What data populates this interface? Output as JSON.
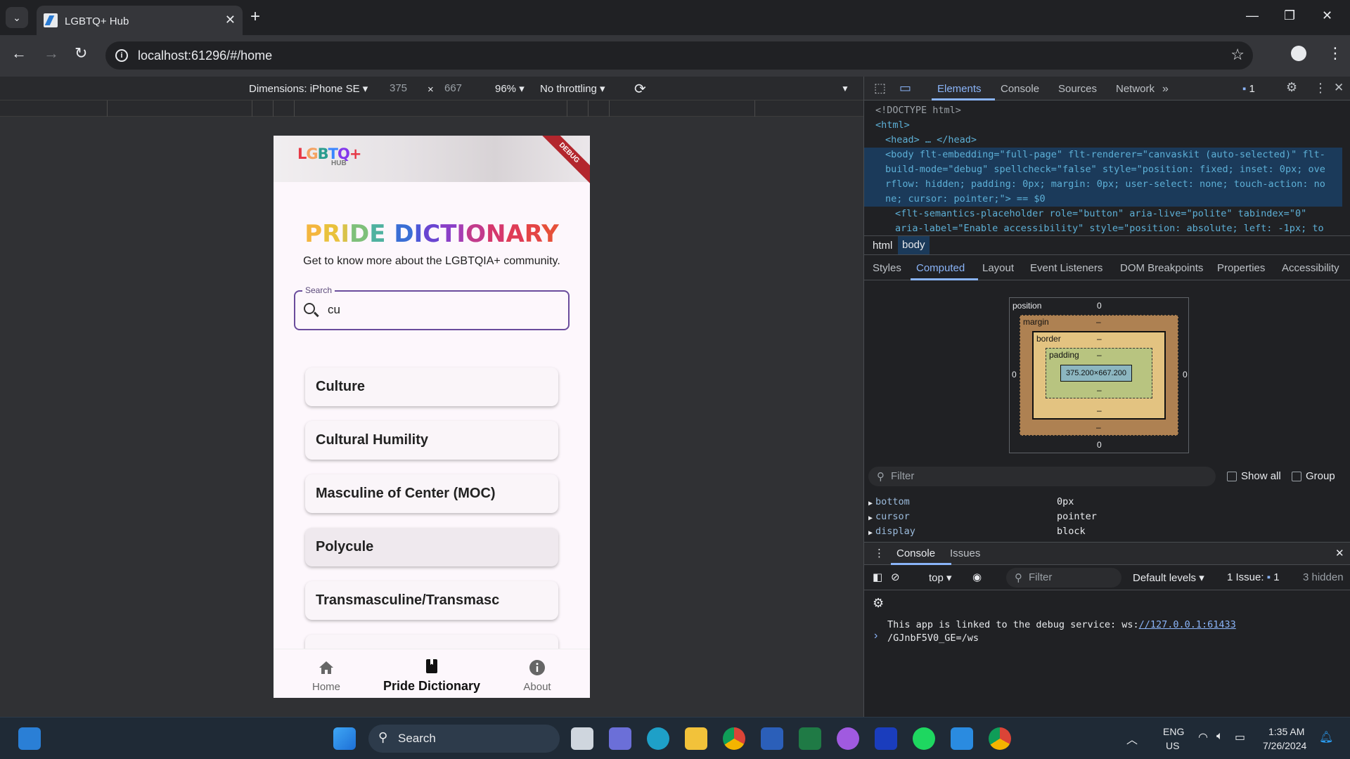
{
  "browser": {
    "tab_title": "LGBTQ+ Hub",
    "url": "localhost:61296/#/home"
  },
  "device_toolbar": {
    "dimensions": "Dimensions: iPhone SE",
    "width": "375",
    "height": "667",
    "zoom": "96%",
    "throttling": "No throttling"
  },
  "app": {
    "logo": "LGBTQ+",
    "logo_sub": "HUB",
    "debug_banner": "DEBUG",
    "title_parts": [
      {
        "text": "P",
        "color": "#f4b63f"
      },
      {
        "text": "R",
        "color": "#e9c13c"
      },
      {
        "text": "I",
        "color": "#d9c24a"
      },
      {
        "text": "D",
        "color": "#7fc07a"
      },
      {
        "text": "E",
        "color": "#4fb2a0"
      },
      {
        "text": " ",
        "color": "#000000"
      },
      {
        "text": "D",
        "color": "#3a6ed5"
      },
      {
        "text": "I",
        "color": "#4d58d8"
      },
      {
        "text": "C",
        "color": "#6a45d1"
      },
      {
        "text": "T",
        "color": "#8a3fc7"
      },
      {
        "text": "I",
        "color": "#a63eb3"
      },
      {
        "text": "O",
        "color": "#c23b8c"
      },
      {
        "text": "N",
        "color": "#d5386d"
      },
      {
        "text": "A",
        "color": "#df3c56"
      },
      {
        "text": "R",
        "color": "#e44545"
      },
      {
        "text": "Y",
        "color": "#e6503a"
      }
    ],
    "subtitle": "Get to know more about the LGBTQIA+ community.",
    "search": {
      "label": "Search",
      "value": "cu"
    },
    "results": [
      "Culture",
      "Cultural Humility",
      "Masculine of Center (MOC)",
      "Polycule",
      "Transmasculine/Transmasc"
    ],
    "nav": {
      "home": "Home",
      "dictionary": "Pride Dictionary",
      "about": "About"
    }
  },
  "devtools": {
    "tabs": [
      "Elements",
      "Console",
      "Sources",
      "Network"
    ],
    "issue_count": "1",
    "dom_lines": [
      "<!DOCTYPE html>",
      "<html>",
      "<head> … </head>",
      "<body flt-embedding=\"full-page\" flt-renderer=\"canvaskit (auto-selected)\" flt-",
      "build-mode=\"debug\" spellcheck=\"false\" style=\"position: fixed; inset: 0px; ove",
      "rflow: hidden; padding: 0px; margin: 0px; user-select: none; touch-action: no",
      "ne; cursor: pointer;\"> == $0",
      "<flt-semantics-placeholder role=\"button\" aria-live=\"polite\" tabindex=\"0\"",
      "aria-label=\"Enable accessibility\" style=\"position: absolute; left: -1px; to"
    ],
    "breadcrumbs": [
      "html",
      "body"
    ],
    "style_tabs": [
      "Styles",
      "Computed",
      "Layout",
      "Event Listeners",
      "DOM Breakpoints",
      "Properties",
      "Accessibility"
    ],
    "box_model": {
      "position_label": "position",
      "margin_label": "margin",
      "border_label": "border",
      "padding_label": "padding",
      "content": "375.200×667.200",
      "zero": "0",
      "dash": "–"
    },
    "filter_placeholder": "Filter",
    "show_all": "Show all",
    "group": "Group",
    "computed_props": [
      {
        "name": "bottom",
        "value": "0px"
      },
      {
        "name": "cursor",
        "value": "pointer"
      },
      {
        "name": "display",
        "value": "block"
      }
    ],
    "drawer_tabs": [
      "Console",
      "Issues"
    ],
    "console_context": "top",
    "console_filter": "Filter",
    "levels": "Default levels",
    "issues_label": "1 Issue:",
    "issues_count": "1",
    "hidden": "3 hidden",
    "console_msg_1": "This app is linked to the debug service: ws:",
    "console_link": "//127.0.0.1:61433",
    "console_msg_2": "/GJnbF5V0_GE=/ws"
  },
  "taskbar": {
    "search": "Search",
    "lang1": "ENG",
    "lang2": "US",
    "time": "1:35 AM",
    "date": "7/26/2024"
  }
}
